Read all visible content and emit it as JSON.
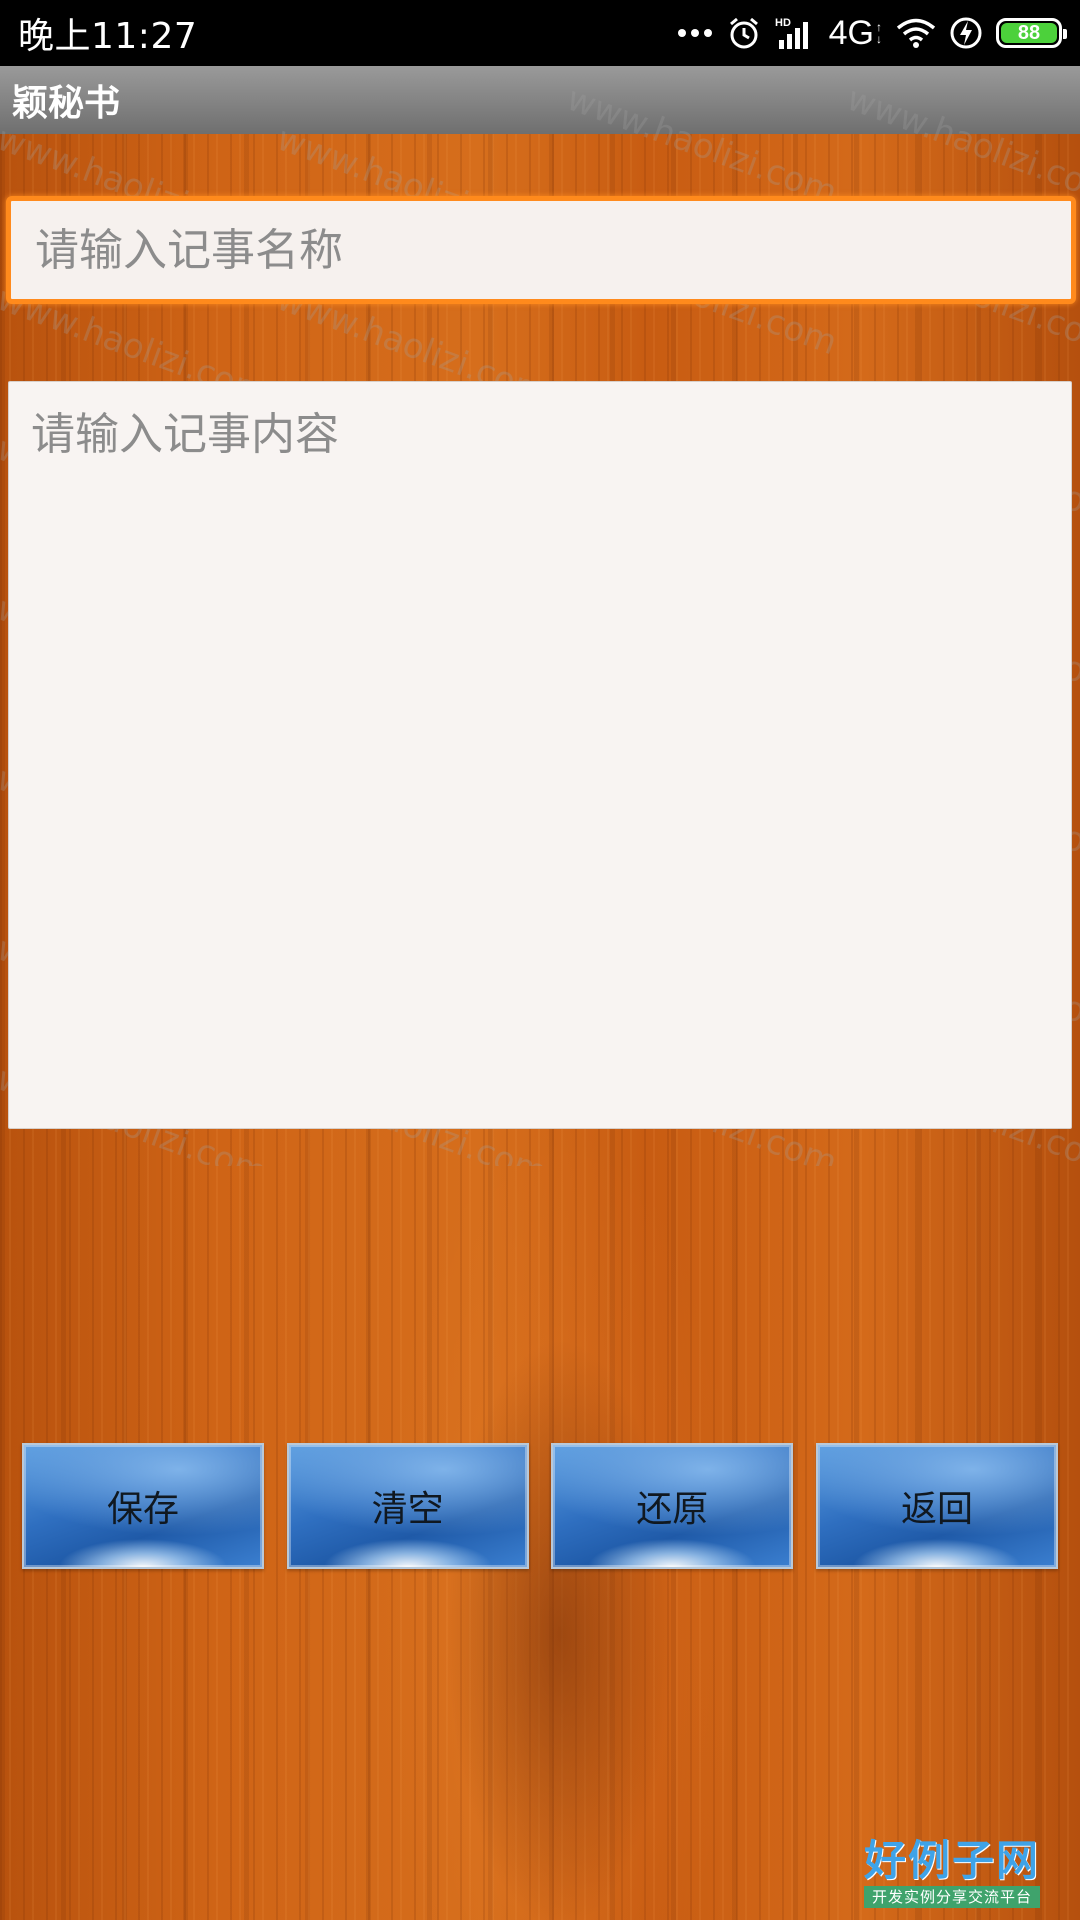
{
  "status_bar": {
    "time": "晚上11:27",
    "network": "4G",
    "network_tag": "HD",
    "battery_level": "88",
    "icons": [
      "more-dots-icon",
      "alarm-icon",
      "signal-icon",
      "wifi-icon",
      "charging-icon",
      "battery-icon"
    ]
  },
  "app_bar": {
    "title": "颖秘书"
  },
  "form": {
    "title_placeholder": "请输入记事名称",
    "title_value": "",
    "content_placeholder": "请输入记事内容",
    "content_value": ""
  },
  "buttons": {
    "save": "保存",
    "clear": "清空",
    "restore": "还原",
    "back": "返回"
  },
  "watermark": {
    "text": "www.haolizi.com"
  },
  "logo": {
    "main": "好例子网",
    "sub": "开发实例分享交流平台"
  },
  "colors": {
    "focus_border": "#ff8a1c",
    "button_blue": "#2f6fc0",
    "wood": "#cf6416"
  }
}
